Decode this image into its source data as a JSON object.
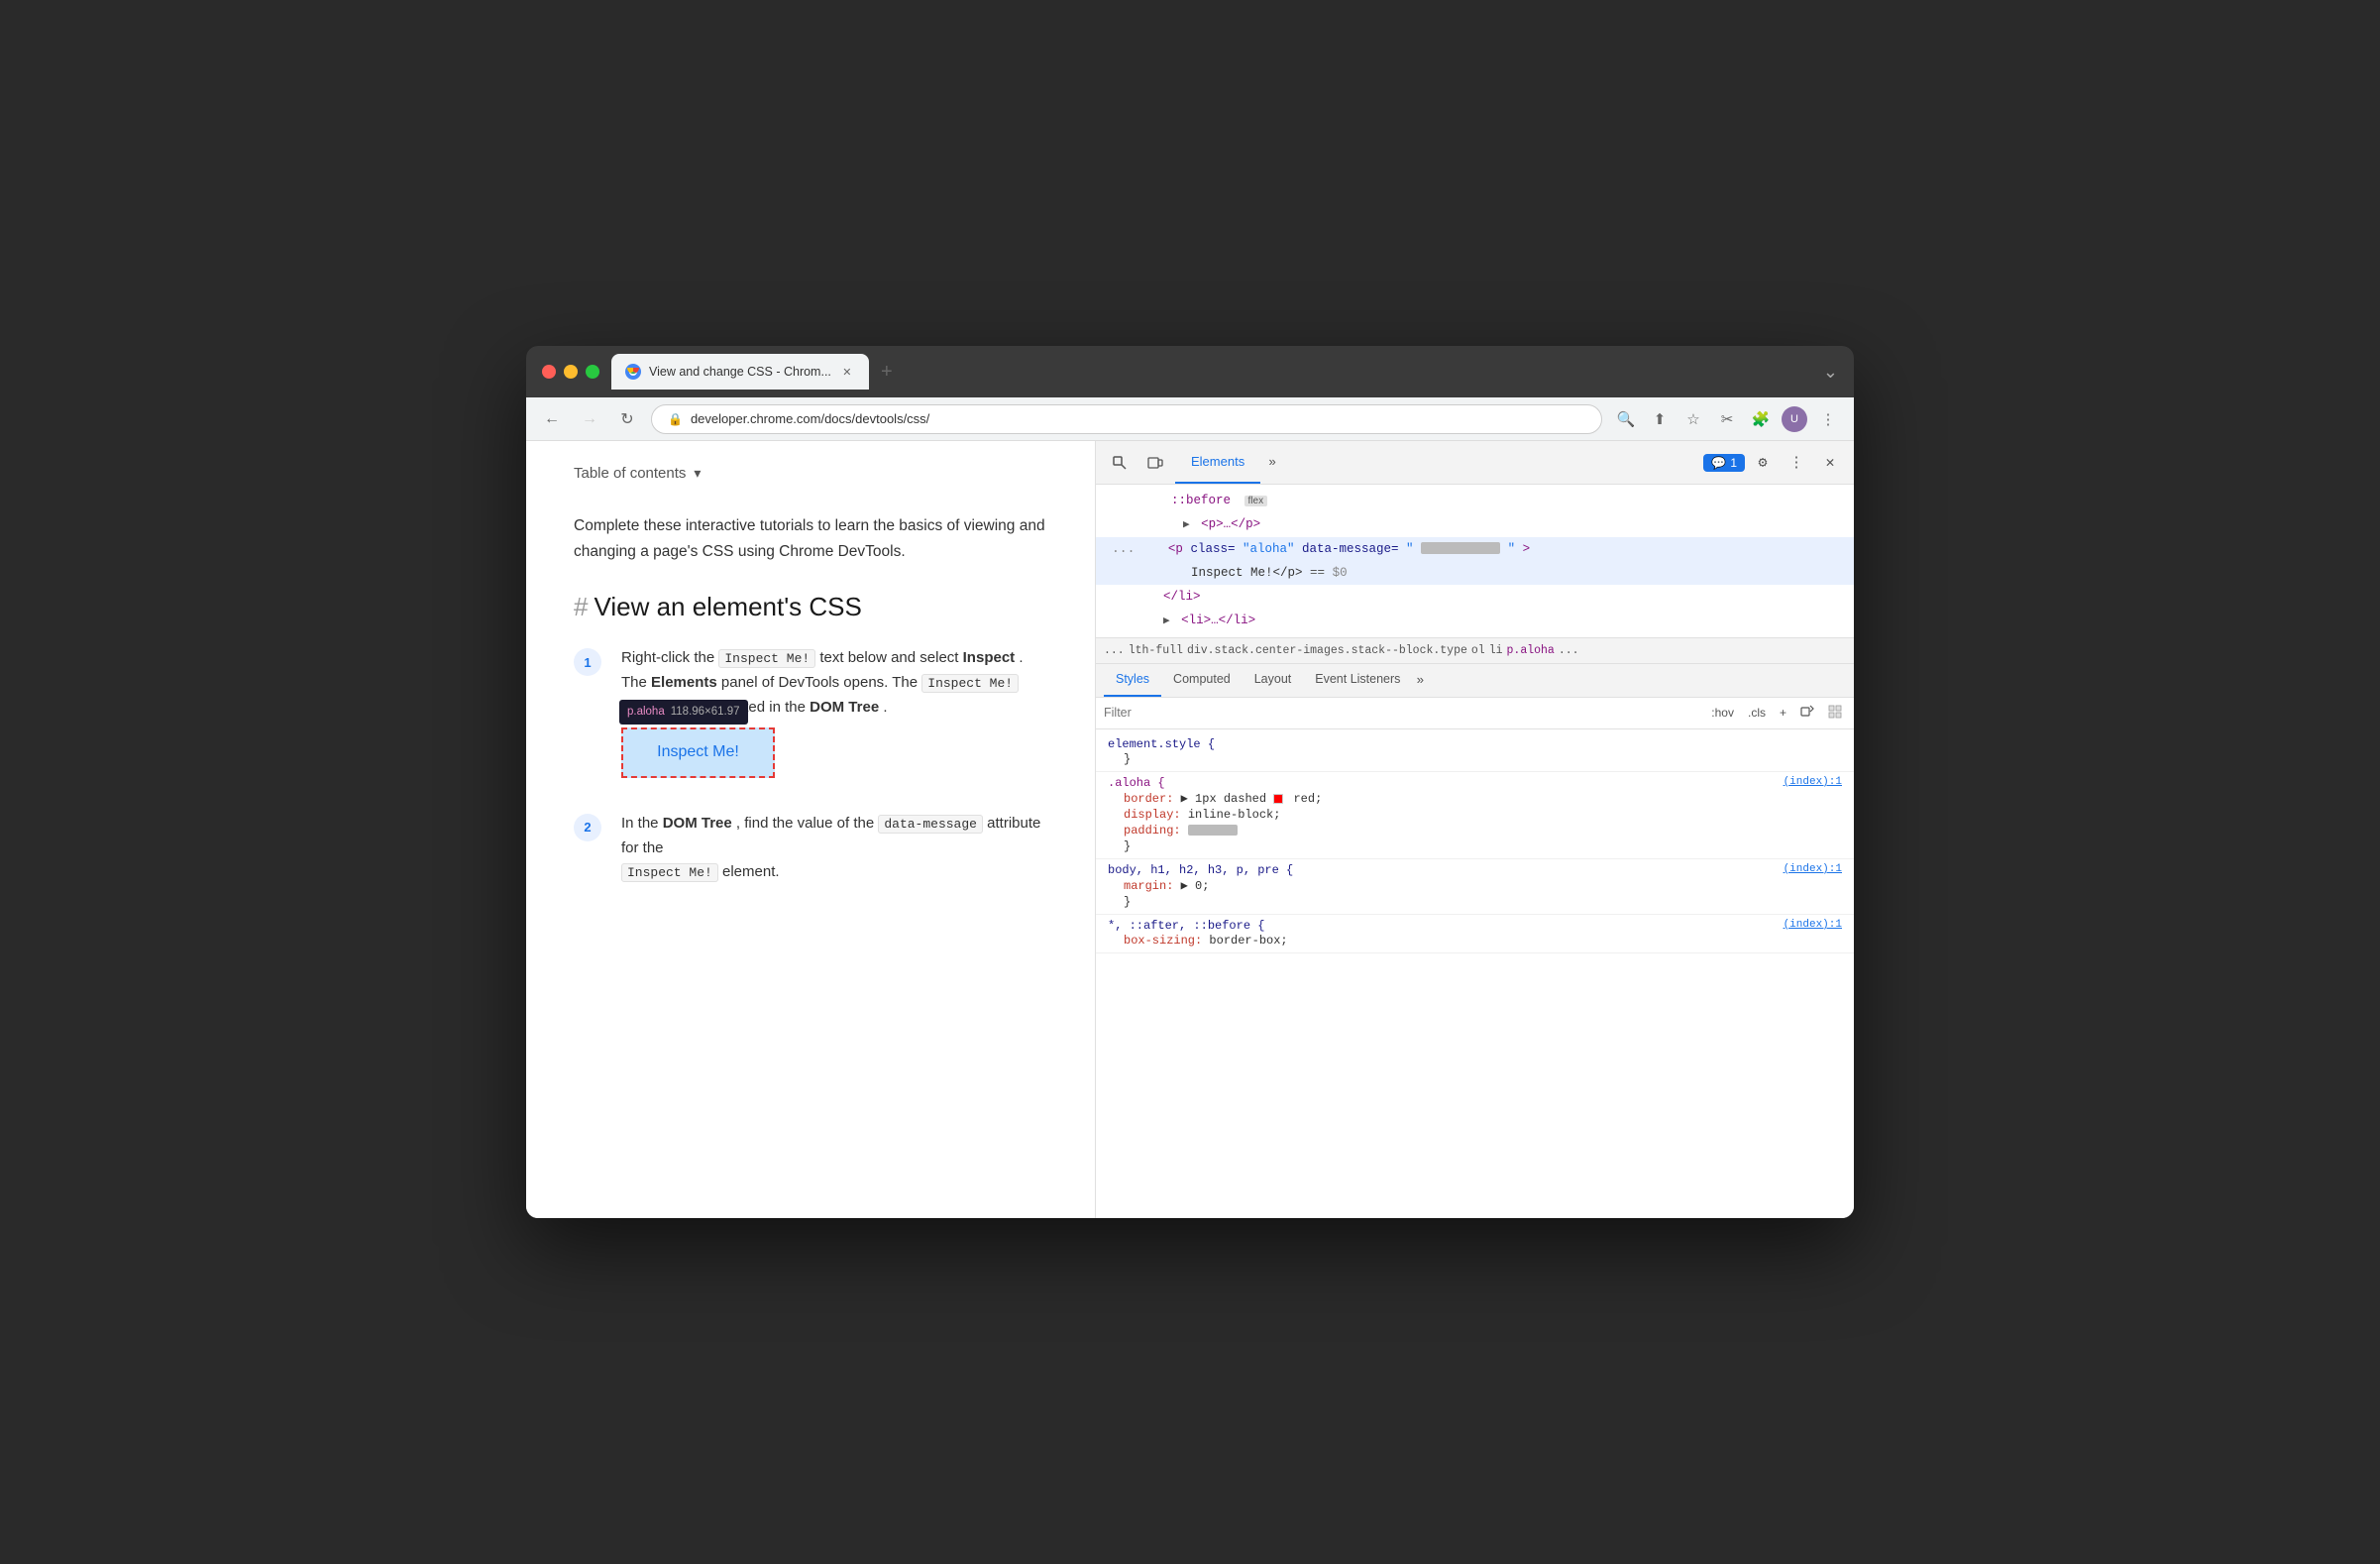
{
  "browser": {
    "tab_title": "View and change CSS - Chrom...",
    "url": "developer.chrome.com/docs/devtools/css/",
    "new_tab_label": "+",
    "menu_label": "⋮"
  },
  "page": {
    "toc_label": "Table of contents",
    "intro": "Complete these interactive tutorials to learn the basics of viewing and changing a page's CSS using Chrome DevTools.",
    "section_heading": "View an element's CSS",
    "step1_label": "Right-click the",
    "step1_inspect_me": "Inspect Me!",
    "step1_text1": "text below and select",
    "step1_bold1": "Inspect",
    "step1_text2": ". The",
    "step1_bold2": "Elements",
    "step1_text3": "panel of DevTools opens. The",
    "step1_inspect_me2": "Inspect Me!",
    "step1_text4": "element is highlighted in the",
    "step1_bold3": "DOM Tree",
    "step1_text5": ".",
    "tooltip_class": "p.aloha",
    "tooltip_dims": "118.96×61.97",
    "inspect_me_button": "Inspect Me!",
    "step2_text1": "In the",
    "step2_bold1": "DOM Tree",
    "step2_text2": ", find the value of the",
    "step2_code": "data-message",
    "step2_text3": "attribute for the",
    "step2_inspect_me": "Inspect Me!",
    "step2_text4": "element."
  },
  "devtools": {
    "panel_title": "Elements",
    "tabs": [
      "Elements",
      ">>"
    ],
    "badge_count": "1",
    "dom_lines": [
      {
        "indent": 0,
        "content": "::before",
        "pseudo": true,
        "badge": "flex"
      },
      {
        "indent": 1,
        "content": "<p>…</p>",
        "tag": true
      },
      {
        "indent": 0,
        "content": "",
        "selected": true,
        "has_attr": true
      },
      {
        "indent": 1,
        "content": "Inspect Me!</p> == $0",
        "text": true
      },
      {
        "indent": 0,
        "content": "</li>",
        "tag": true
      },
      {
        "indent": 1,
        "content": "<li>…</li>",
        "tag": true
      }
    ],
    "breadcrumb": "... lth-full   div.stack.center-images.stack--block.type   ol   li   p.aloha   ...",
    "style_tabs": [
      "Styles",
      "Computed",
      "Layout",
      "Event Listeners",
      ">>"
    ],
    "filter_placeholder": "Filter",
    "filter_hov": ":hov",
    "filter_cls": ".cls",
    "css_rules": [
      {
        "selector": "element.style {",
        "selector_type": "element",
        "source": "",
        "props": [
          {
            "prop": "",
            "value": "}"
          }
        ]
      },
      {
        "selector": ".aloha {",
        "selector_type": "class",
        "source": "(index):1",
        "props": [
          {
            "prop": "border:",
            "value": "▶ 1px dashed",
            "has_swatch": true,
            "swatch_color": "red",
            "value2": "red;"
          },
          {
            "prop": "display:",
            "value": "inline-block;"
          },
          {
            "prop": "padding:",
            "value": "",
            "redacted": true
          }
        ]
      },
      {
        "selector": "body, h1, h2, h3, p, pre {",
        "selector_type": "element",
        "source": "(index):1",
        "props": [
          {
            "prop": "margin:",
            "value": "▶ 0;"
          }
        ]
      },
      {
        "selector": "*, ::after, ::before {",
        "selector_type": "element",
        "source": "(index):1",
        "props": [
          {
            "prop": "box-sizing:",
            "value": "border-box;"
          }
        ]
      }
    ]
  }
}
